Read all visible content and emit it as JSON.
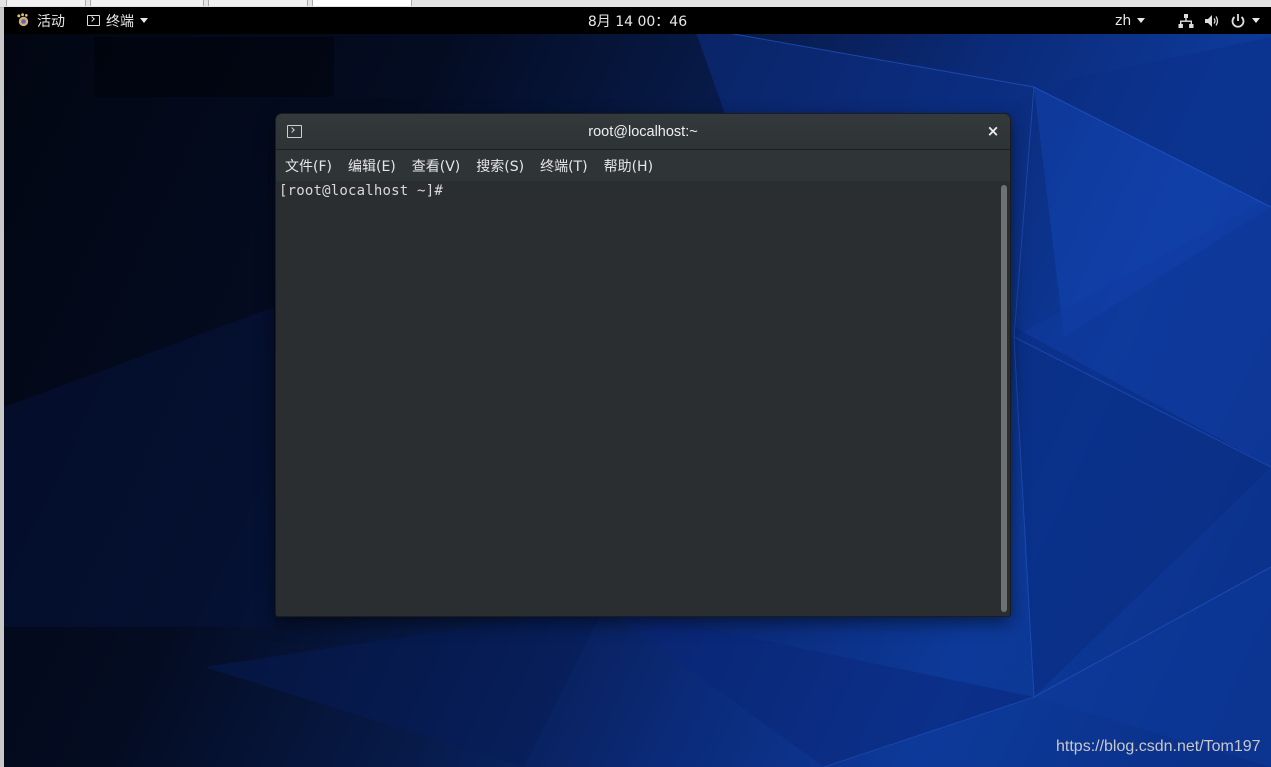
{
  "panel": {
    "activities_label": "活动",
    "app_menu_label": "终端",
    "clock": "8月 14 00：46",
    "language": "zh"
  },
  "window": {
    "title": "root@localhost:~",
    "close_glyph": "×"
  },
  "menu": {
    "items": [
      {
        "label": "文件(F)"
      },
      {
        "label": "编辑(E)"
      },
      {
        "label": "查看(V)"
      },
      {
        "label": "搜索(S)"
      },
      {
        "label": "终端(T)"
      },
      {
        "label": "帮助(H)"
      }
    ]
  },
  "terminal": {
    "prompt": "[root@localhost ~]#"
  },
  "watermark": "https://blog.csdn.net/Tom197",
  "icons": {
    "activities": "gnome-foot-icon",
    "app_menu": "terminal-icon",
    "network": "network-wired-icon",
    "volume": "volume-icon",
    "power": "power-icon"
  },
  "colors": {
    "panel_bg": "#000000",
    "terminal_bg": "#2a2e30",
    "desktop_accent": "#0d3a9a"
  }
}
